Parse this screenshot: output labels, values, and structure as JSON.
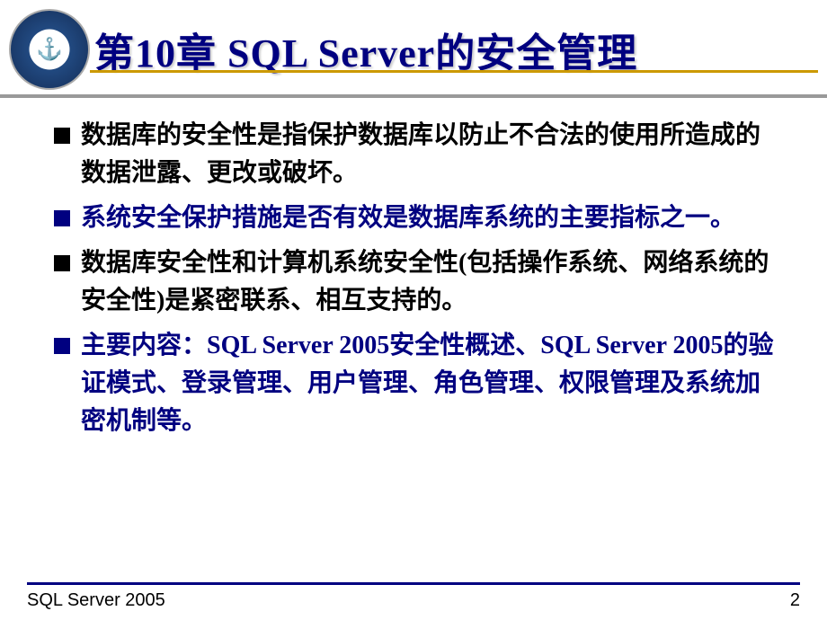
{
  "slide": {
    "title": "第10章  SQL Server的安全管理",
    "bullets": [
      {
        "text": "数据库的安全性是指保护数据库以防止不合法的使用所造成的数据泄露、更改或破坏。",
        "color": "black"
      },
      {
        "text": "系统安全保护措施是否有效是数据库系统的主要指标之一。",
        "color": "blue"
      },
      {
        "text": "数据库安全性和计算机系统安全性(包括操作系统、网络系统的安全性)是紧密联系、相互支持的。",
        "color": "black"
      },
      {
        "label": "主要内容",
        "text": "：SQL Server 2005安全性概述、SQL Server 2005的验证模式、登录管理、用户管理、角色管理、权限管理及系统加密机制等。",
        "color": "blue"
      }
    ],
    "footer": {
      "text": "SQL Server 2005",
      "page": "2"
    }
  }
}
